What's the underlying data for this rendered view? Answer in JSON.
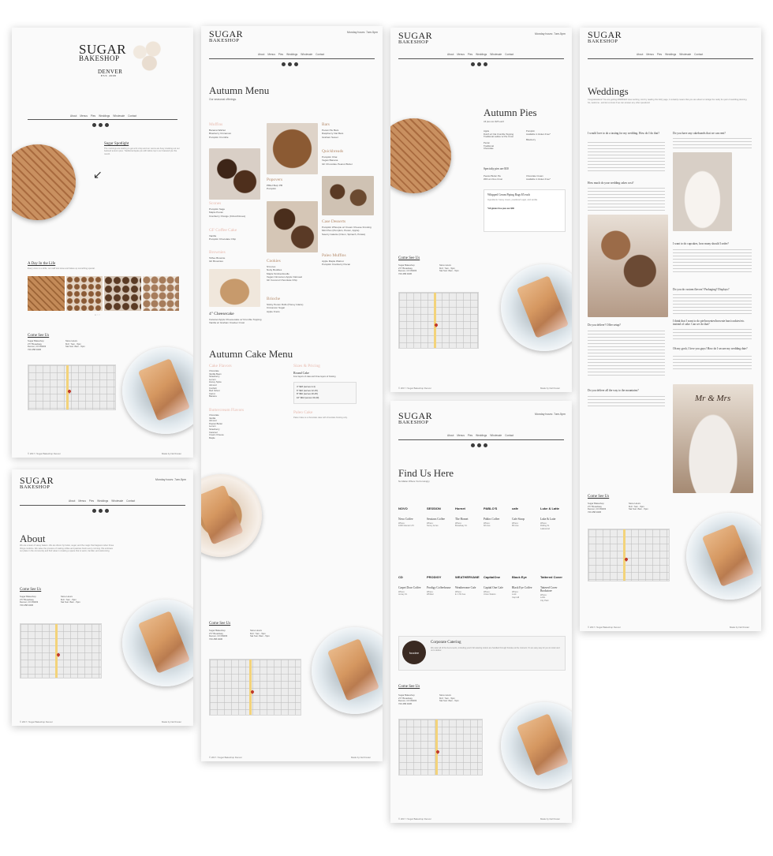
{
  "brand": {
    "name_line1": "SUGAR",
    "name_line2": "BAKESHOP",
    "city": "DENVER",
    "est": "EST. 2008"
  },
  "hours": "Monday hours: 7am-5pm",
  "nav": [
    "About",
    "Menus",
    "Pies",
    "Weddings",
    "Wholesale",
    "Contact"
  ],
  "footer": {
    "copyright": "© 2017 / Sugar Bakeshop Denver",
    "credit": "Made by Nell Foster"
  },
  "home": {
    "spotlight_title": "Sugar Spotlight",
    "spotlight_text": "The mornings are starting to get a bit crisp and our ovens are busy cranking out our beloved autumn pies. Traditional Apple pie with lattice top is our featured pie this month.",
    "day_title": "A Day In the Life",
    "day_text": "Every once in a while, our staff lets loose and bakes up something special."
  },
  "visit": {
    "title": "Come See Us",
    "address": "Sugar Bakeshop\n277 Broadway\nDenver, CO 80203\n720.458.9436",
    "store_hours": "Store Hours\nM-F: 7am - 5pm\nSat Sun: 8am - 5pm"
  },
  "autumn_menu": {
    "title": "Autumn Menu",
    "subtitle": "Our seasonal offerings.",
    "muffins_h": "Muffins",
    "muffins": "Banana Walnut\nBlueberry Cinnamon\nPumpkin Crumble",
    "scones_h": "Scones",
    "scones": "Pumpkin Sage\nMaple Pecan\nCranberry Orange (Citrus/Cloves)",
    "gf_h": "GF Coffee Cake",
    "gf": "Vanilla\nPumpkin Chocolate Chip",
    "brownies_h": "Brownies",
    "brownies": "Toffee Brownie\nGF Brownies",
    "cheesecake_h": "4\" Cheesecake",
    "cheesecake": "Caramel Apple Cheesecake w/ Crumble Topping\nVanilla w/ Graham Cracker Crust",
    "bars_h": "Bars",
    "bars": "Pecan Pie Bars\nRaspberry Oat Bars\nGraham Sweet",
    "quick_h": "Quickbreads",
    "quick": "Pumpkin Chai\nVegan Banana\nGF Chocolate Peanut Butter",
    "popovers_h": "Popovers",
    "popovers": "PB&J Burp PB\nPumpkin",
    "case_h": "Case Desserts",
    "case": "Pumpkin Whoopie w/ Cream Cheese Frosting\nMini Pies (Pumpkin, Pecan, Apple)\nSavory Galette (Onion, Spinach, Potato)",
    "cookies_h": "Cookies",
    "cookies": "S'mores\nNutty Buddies\nMaple Snickerdoodle\nVegan Cinnamon Apple Oatmeal\nGF Coconut Chocolate Chip",
    "paleo_h": "Paleo Muffins",
    "paleo": "Apple Maple Walnut\nPumpkin Cranberry Pecan",
    "brioche_h": "Brioche",
    "brioche": "Sticky Pecan Rolls (Honey Glaze)\nCinnamon Sugar\nApple Knots"
  },
  "cake_menu": {
    "title": "Autumn Cake Menu",
    "cake_flavors_h": "Cake Flavors",
    "cake_flavors": "Chocolate\nVanilla Bean\nStrawberry\nLemon\nHoney Spice\nAlmond\nConfetti\nRed Velvet\nCarrot\nBanana",
    "butter_h": "Buttercream Flavors",
    "butter": "Chocolate\nVanilla\nAlmond\nPeanut Butter\nLemon\nStrawberry\nCaramel\nCream Cheese\nMaple",
    "sizes_h": "Sizes & Pricing",
    "round_h": "Round Cake",
    "round_sub": "Four layers of cake and three layers of frosting",
    "sizes": "4\" $18 (serves 2-4)\n6\" $42 (serves 12-15)\n8\" $52 (serves 20-25)\n10\" $62 (serves 30-40)",
    "paleo_h": "Paleo Cake",
    "paleo_text": "Paleo Cake is a chocolate cake with chocolate frosting only."
  },
  "autumn_pies": {
    "title": "Autumn Pies",
    "subtitle": "All pies are $25 each",
    "col1": "Apple\nDutch w/ Oat Crumble Topping\nTraditional Lattice w/ Pie Crust\n\nPecan\nTraditional\nChocolate",
    "col2": "Pumpkin\nAvailable in Gluten Free*\n\nBlueberry",
    "specialty": "Specialty pies are $30",
    "specialty1": "Peanut Butter Pie\nWith an Oreo Crust",
    "specialty2": "Chocolate Cream\nAvailable in Gluten Free*",
    "whip_title": "Whipped Cream Piping Bags $5 each",
    "whip_text": "Ingredients: heavy cream, powdered sugar, and vanilla.",
    "gf_note": "*All gluten free pies are $30"
  },
  "about": {
    "title": "About",
    "text": "We are a team of sassy bakers. We are driven by butter, sugar, and the magic that happens when those things combine. We value the process of making coffee and pastries fresh every morning. We embrace our place in the community and find value in creating a space that is warm, familiar, and welcoming."
  },
  "find_us": {
    "title": "Find Us Here",
    "subtitle": "No Matter Where You're Hungry.",
    "row1": [
      {
        "logo": "NOVO",
        "name": "Novo Coffee",
        "where": "Where:\n1600 Glenarm Pl."
      },
      {
        "logo": "SESSION",
        "name": "Sessions Coffee",
        "where": "Where:\nSunny Acres"
      },
      {
        "logo": "Hornet",
        "name": "The Hornet",
        "where": "Where:\nBroadway St."
      },
      {
        "logo": "PABLO'S",
        "name": "Pablos Coffee",
        "where": "Where:\n6th Ave"
      },
      {
        "logo": "cafe",
        "name": "Cafe Stoop",
        "where": "Where:\n8th Ave"
      },
      {
        "logo": "Luke & Latte",
        "name": "Luke & Latte",
        "where": "Where:\nRolling St.\nLakewood"
      }
    ],
    "row2": [
      {
        "logo": "CD",
        "name": "Carpet Door Coffee",
        "where": "Where:\nJersey St."
      },
      {
        "logo": "PRODIGY",
        "name": "Prodigy Coffeehouse",
        "where": "Where:\nWhittier"
      },
      {
        "logo": "WEATHERVANE",
        "name": "Weathervane Cafe",
        "where": "Where:\nE. 17th Ave"
      },
      {
        "logo": "CapitalOne",
        "name": "Capital One Cafe",
        "where": "Where:\nUnion Station"
      },
      {
        "logo": "Black Eye",
        "name": "Black Eye Coffee",
        "where": "Where:\nLoHi\nCap Hill"
      },
      {
        "logo": "Tattered Cover",
        "name": "Tattered Cover Bookstore",
        "where": "Where:\nLoDo\nCity Park"
      }
    ],
    "catering_title": "Corporate Catering",
    "catering_text": "We cater all of the best events, including yours! All catering orders are handled through Foodee at the moment. It's an easy way for you to order and us to deliver.",
    "foodee": "foodee"
  },
  "weddings": {
    "title": "Weddings",
    "intro": "Congratulations! You are getting MARRIED! How exciting. And by reading this FAQ page, it certainly means that you are about to indulge the really fun part of wedding planning. So, welcome...and let us know if we can answer any other questions!",
    "q1": "I would love to do a tasting for my wedding. How do I do that?",
    "q2": "How much do your wedding cakes cost?",
    "q3": "Do you deliver? Offer setup?",
    "q4": "Do you deliver all the way to the mountains?",
    "q5": "Do you have any cakeboards that we can rent?",
    "q6": "I want to do cupcakes, how many should I order?",
    "q7": "Do you do custom flavors? Packaging? Displays?",
    "q8": "I think that I want to do pie/brownies/brownie bars/cookies/etc. instead of cake. Can we do that?",
    "q9": "Oh my gosh, I love you guys! How do I secure my wedding date?",
    "cake_topper": "Mr & Mrs"
  },
  "colors": {
    "accent_tan": "#b48a6a",
    "accent_pink": "#e7b8ac",
    "text": "#333333",
    "rule": "#555555"
  }
}
